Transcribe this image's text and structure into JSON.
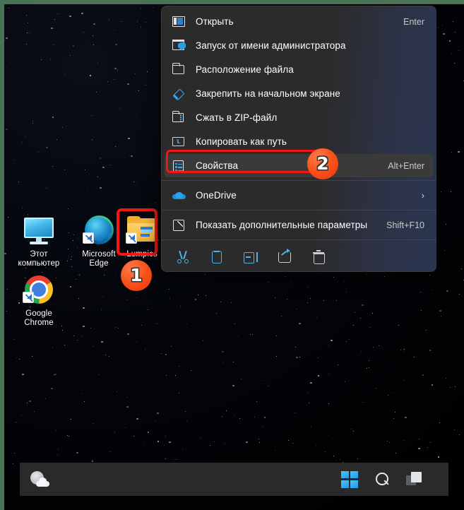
{
  "frame": {
    "accent_color": "#4a7254"
  },
  "desktop": {
    "icons": [
      {
        "name": "this-pc",
        "label_line1": "Этот",
        "label_line2": "компьютер",
        "icon": "monitor-icon"
      },
      {
        "name": "microsoft-edge",
        "label_line1": "Microsoft",
        "label_line2": "Edge",
        "icon": "edge-icon"
      },
      {
        "name": "lumpics",
        "label_line1": "Lumpics",
        "label_line2": "",
        "icon": "folder-shortcut-icon"
      },
      {
        "name": "google-chrome",
        "label_line1": "Google",
        "label_line2": "Chrome",
        "icon": "chrome-icon"
      }
    ],
    "highlight_color": "#f41515"
  },
  "context_menu": {
    "items": [
      {
        "label": "Открыть",
        "accel": "Enter",
        "icon": "open-window-icon",
        "submenu": false,
        "selected": false
      },
      {
        "label": "Запуск от имени администратора",
        "accel": "",
        "icon": "shield-admin-icon",
        "submenu": false,
        "selected": false
      },
      {
        "label": "Расположение файла",
        "accel": "",
        "icon": "folder-icon",
        "submenu": false,
        "selected": false
      },
      {
        "label": "Закрепить на начальном экране",
        "accel": "",
        "icon": "pin-icon",
        "submenu": false,
        "selected": false
      },
      {
        "label": "Сжать в ZIP-файл",
        "accel": "",
        "icon": "zip-archive-icon",
        "submenu": false,
        "selected": false
      },
      {
        "label": "Копировать как путь",
        "accel": "",
        "icon": "copy-path-icon",
        "submenu": false,
        "selected": false
      },
      {
        "label": "Свойства",
        "accel": "Alt+Enter",
        "icon": "properties-icon",
        "submenu": false,
        "selected": true
      },
      {
        "label": "OneDrive",
        "accel": "",
        "icon": "onedrive-cloud-icon",
        "submenu": true,
        "selected": false
      },
      {
        "label": "Показать дополнительные параметры",
        "accel": "Shift+F10",
        "icon": "more-options-icon",
        "submenu": false,
        "selected": false
      }
    ],
    "submenu_chevron": "›",
    "actions": [
      {
        "name": "cut-action",
        "icon": "scissors-icon"
      },
      {
        "name": "copy-action",
        "icon": "copy-icon"
      },
      {
        "name": "rename-action",
        "icon": "rename-icon"
      },
      {
        "name": "share-action",
        "icon": "share-icon"
      },
      {
        "name": "delete-action",
        "icon": "trash-icon"
      }
    ],
    "selected_highlight_color": "#f41515"
  },
  "badges": [
    {
      "number": "1",
      "target": "lumpics-desktop-icon"
    },
    {
      "number": "2",
      "target": "properties-menu-item"
    }
  ],
  "taskbar": {
    "widget": {
      "name": "weather-widget",
      "icon": "weather-cloud-icon"
    },
    "buttons": [
      {
        "name": "start-button",
        "icon": "windows-logo-icon"
      },
      {
        "name": "search-button",
        "icon": "search-icon"
      },
      {
        "name": "task-view-button",
        "icon": "task-view-icon"
      }
    ]
  }
}
